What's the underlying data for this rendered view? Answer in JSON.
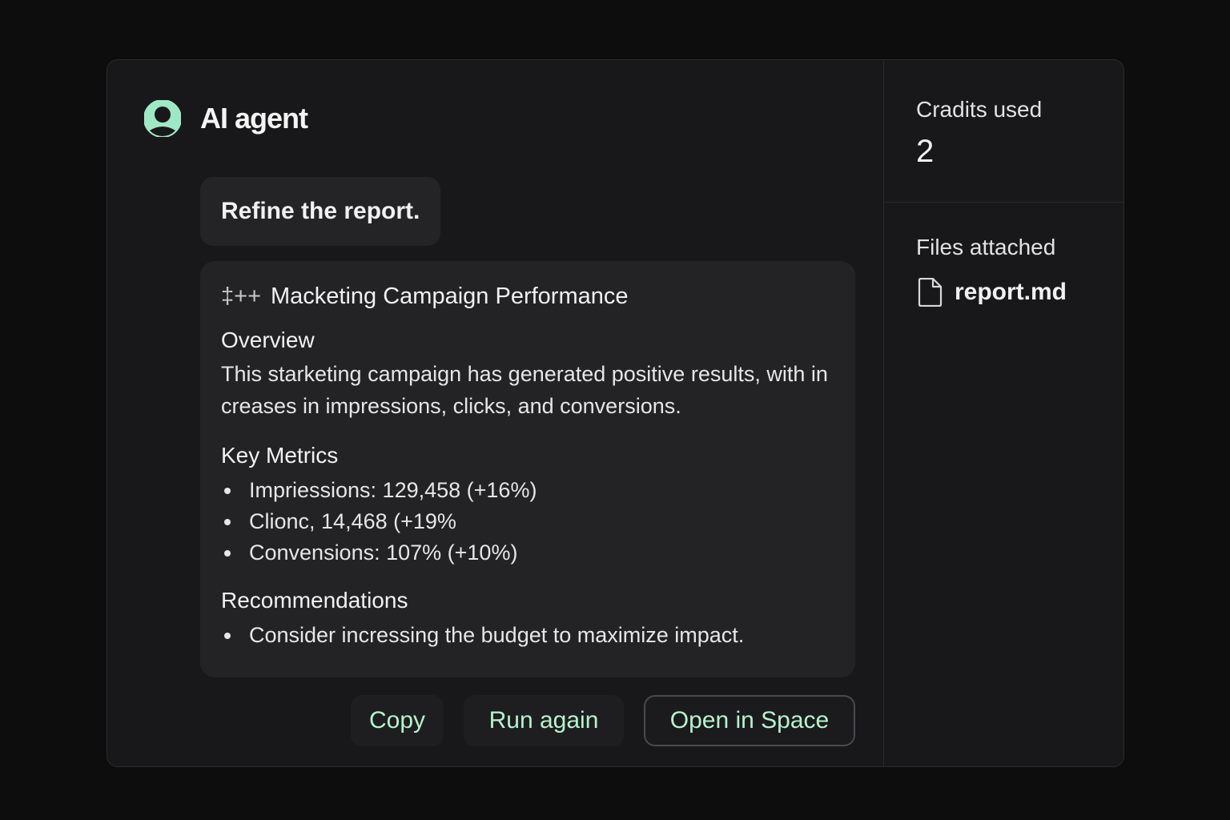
{
  "header": {
    "title": "AI agent",
    "icon": "user-avatar-icon",
    "accent_color": "#9fe8c5"
  },
  "conversation": {
    "user_message": "Refine the report.",
    "report": {
      "heading_prefix": "‡++",
      "heading": "Macketing Campaign Performance",
      "overview_title": "Overview",
      "overview_text": "This starketing campaign has generated positive results, with in creases in impressions, clicks, and conversions.",
      "metrics_title": "Key Metrics",
      "metrics": [
        "Impriessions: 129,458 (+16%)",
        "Clionc, 14,468 (+19%",
        "Convensions: 107% (+10%)"
      ],
      "recommendations_title": "Recommendations",
      "recommendations": [
        "Consider incressing the budget to maximize impact."
      ]
    }
  },
  "actions": {
    "copy_label": "Copy",
    "run_again_label": "Run again",
    "open_in_space_label": "Open in Space",
    "button_text_color": "#b6f2cf"
  },
  "sidebar": {
    "credits_label": "Cradits used",
    "credits_value": "2",
    "files_label": "Files attached",
    "files": [
      {
        "name": "report.md",
        "icon": "file-icon"
      }
    ]
  }
}
